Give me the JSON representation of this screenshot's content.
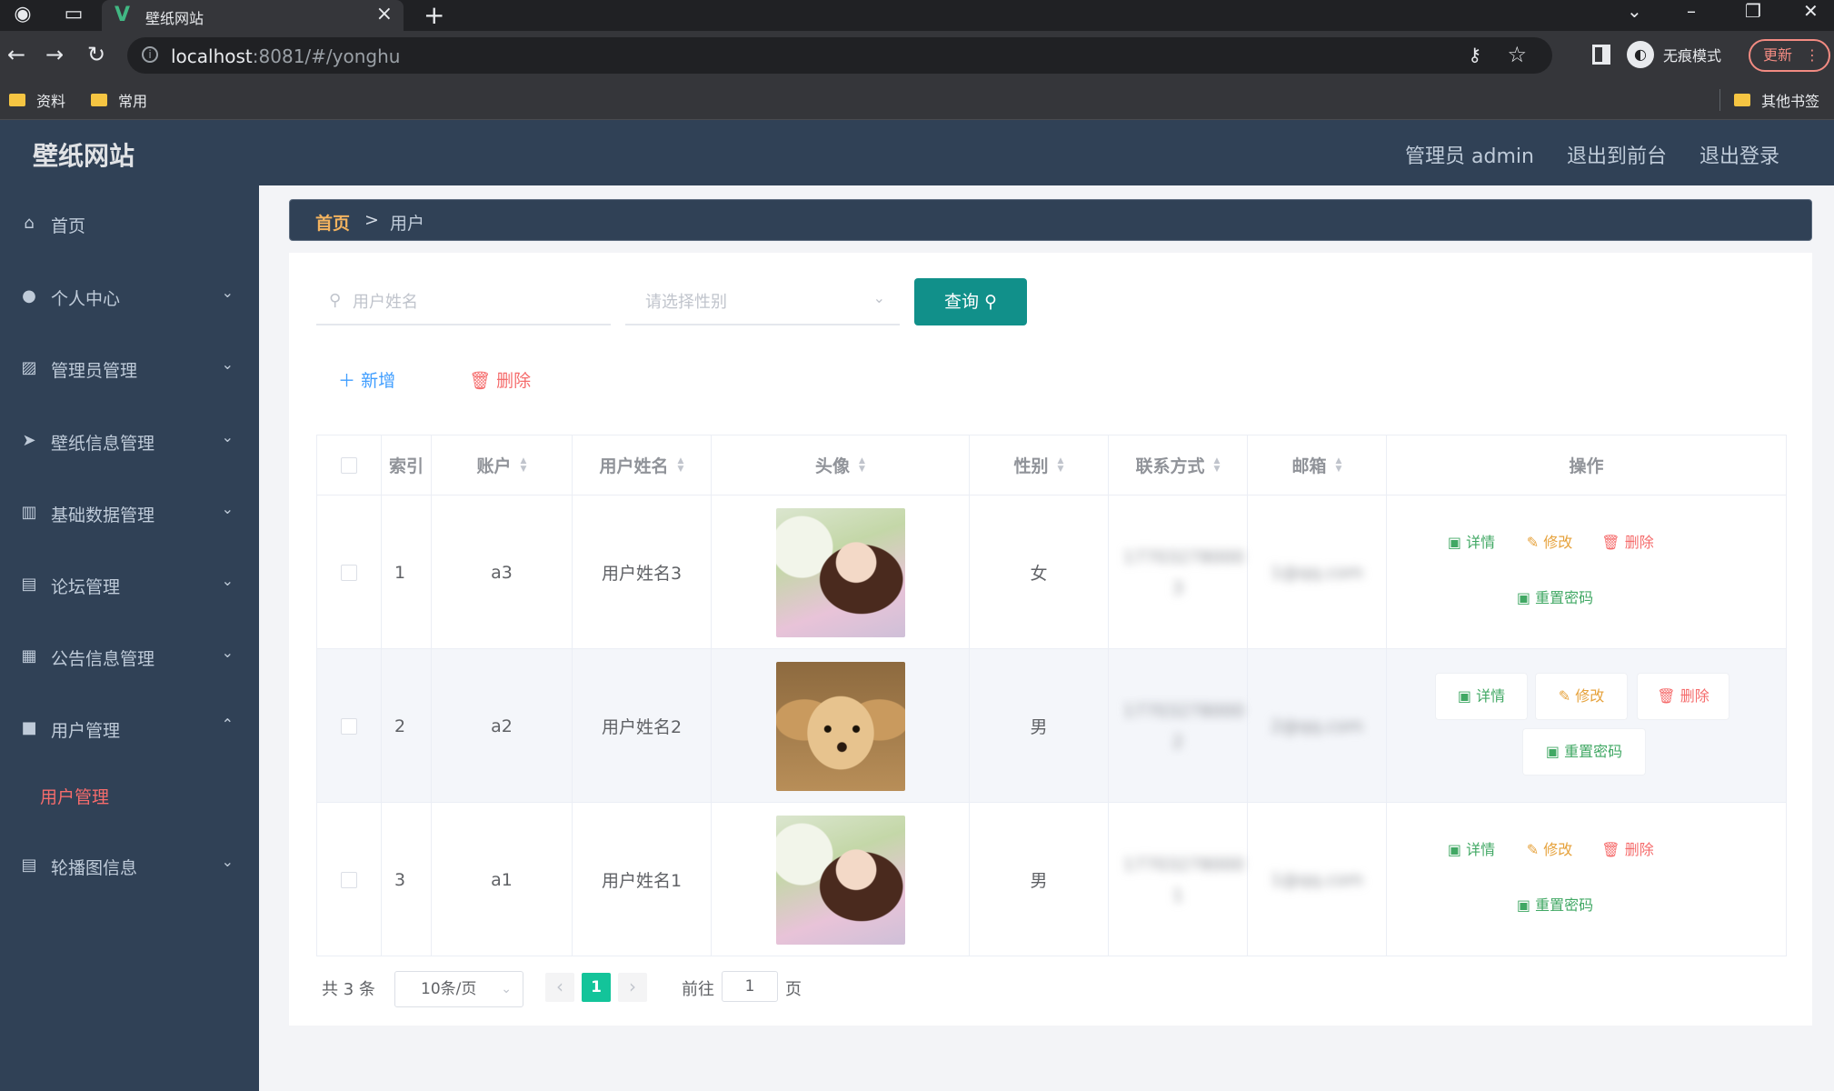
{
  "browser": {
    "tab_title": "壁纸网站",
    "url_host": "localhost",
    "url_rest": ":8081/#/yonghu",
    "incognito_label": "无痕模式",
    "update_label": "更新",
    "bookmarks": [
      "资料",
      "常用"
    ],
    "other_bookmarks": "其他书签"
  },
  "header": {
    "brand": "壁纸网站",
    "admin_label": "管理员 admin",
    "back_to_front": "退出到前台",
    "logout": "退出登录"
  },
  "sidebar": {
    "items": [
      {
        "label": "首页",
        "icon": "home-icon",
        "expandable": false
      },
      {
        "label": "个人中心",
        "icon": "user-icon",
        "expandable": true
      },
      {
        "label": "管理员管理",
        "icon": "chart-icon",
        "expandable": true
      },
      {
        "label": "壁纸信息管理",
        "icon": "send-icon",
        "expandable": true
      },
      {
        "label": "基础数据管理",
        "icon": "bars-icon",
        "expandable": true
      },
      {
        "label": "论坛管理",
        "icon": "printer-icon",
        "expandable": true
      },
      {
        "label": "公告信息管理",
        "icon": "clipboard-icon",
        "expandable": true
      },
      {
        "label": "用户管理",
        "icon": "camera-icon",
        "expandable": true,
        "expanded": true
      },
      {
        "label": "轮播图信息",
        "icon": "document-icon",
        "expandable": true
      }
    ],
    "active_sub": "用户管理"
  },
  "breadcrumb": {
    "home": "首页",
    "separator": ">",
    "current": "用户"
  },
  "search": {
    "name_placeholder": "用户姓名",
    "gender_placeholder": "请选择性别",
    "query_label": "查询"
  },
  "actions": {
    "add": "新增",
    "delete": "删除"
  },
  "table": {
    "headers": [
      "索引",
      "账户",
      "用户姓名",
      "头像",
      "性别",
      "联系方式",
      "邮箱",
      "操作"
    ],
    "rows": [
      {
        "index": "1",
        "account": "a3",
        "name": "用户姓名3",
        "avatar": "girl",
        "gender": "女",
        "phone": "17703278000 3",
        "email": "1@qq.com"
      },
      {
        "index": "2",
        "account": "a2",
        "name": "用户姓名2",
        "avatar": "dog",
        "gender": "男",
        "phone": "17703278000 2",
        "email": "2@qq.com"
      },
      {
        "index": "3",
        "account": "a1",
        "name": "用户姓名1",
        "avatar": "girl",
        "gender": "男",
        "phone": "17703278000 1",
        "email": "1@qq.com"
      }
    ],
    "op_labels": {
      "detail": "详情",
      "edit": "修改",
      "delete": "删除",
      "reset": "重置密码"
    }
  },
  "pagination": {
    "total": "共 3 条",
    "page_size": "10条/页",
    "current_page": "1",
    "goto_prefix": "前往",
    "goto_value": "1",
    "goto_suffix": "页"
  },
  "colors": {
    "sidebar_bg": "#304156",
    "accent_teal": "#11908a",
    "active_red": "#f56c6c"
  }
}
